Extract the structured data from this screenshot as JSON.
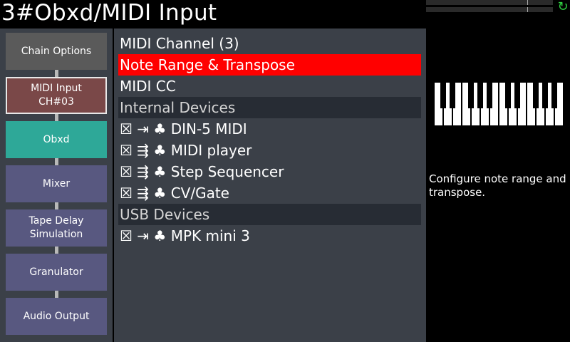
{
  "header": {
    "title": "3#Obxd/MIDI Input",
    "refresh_icon": "↻"
  },
  "chain": {
    "items": [
      {
        "label": "Chain Options",
        "state": "normal"
      },
      {
        "label": "MIDI Input\nCH#03",
        "state": "selected"
      },
      {
        "label": "Obxd",
        "state": "synth"
      },
      {
        "label": "Mixer",
        "state": "audio"
      },
      {
        "label": "Tape Delay\nSimulation",
        "state": "audio"
      },
      {
        "label": "Granulator",
        "state": "audio"
      },
      {
        "label": "Audio Output",
        "state": "audio"
      }
    ]
  },
  "menu": {
    "items": [
      {
        "text": "MIDI Channel (3)",
        "kind": "item"
      },
      {
        "text": "Note Range & Transpose",
        "kind": "selected"
      },
      {
        "text": "MIDI CC",
        "kind": "item"
      },
      {
        "text": "Internal Devices",
        "kind": "section"
      },
      {
        "text": "☒ ⇥ ♣ DIN-5 MIDI",
        "kind": "item"
      },
      {
        "text": "☒ ⇶ ♣ MIDI player",
        "kind": "item"
      },
      {
        "text": "☒ ⇶ ♣ Step Sequencer",
        "kind": "item"
      },
      {
        "text": "☒ ⇶ ♣ CV/Gate",
        "kind": "item"
      },
      {
        "text": "USB Devices",
        "kind": "section"
      },
      {
        "text": "☒ ⇥ ♣ MPK mini 3",
        "kind": "item"
      }
    ]
  },
  "info": {
    "icon": "piano-keyboard-icon",
    "description": "Configure note range and transpose."
  },
  "colors": {
    "selected_item": "#ff0000",
    "background_panel": "#3b4048",
    "section_header": "#272c34",
    "synth_slot": "#2ea898",
    "audio_slot": "#585880",
    "midi_slot": "#7a4848",
    "chain_options": "#5a5a5a"
  }
}
